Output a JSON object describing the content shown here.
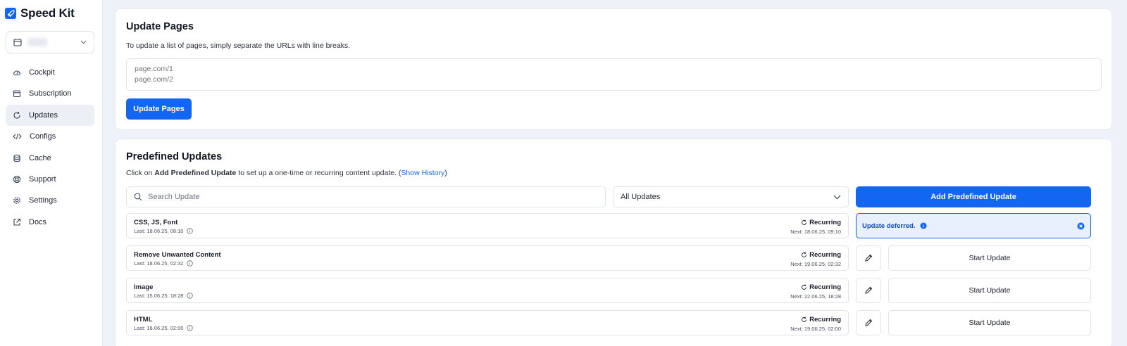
{
  "brand": {
    "name": "Speed Kit"
  },
  "sidebar": {
    "items": [
      {
        "label": "Cockpit",
        "icon": "gauge-icon",
        "active": false
      },
      {
        "label": "Subscription",
        "icon": "calendar-icon",
        "active": false
      },
      {
        "label": "Updates",
        "icon": "refresh-icon",
        "active": true
      },
      {
        "label": "Configs",
        "icon": "code-icon",
        "active": false
      },
      {
        "label": "Cache",
        "icon": "database-icon",
        "active": false
      },
      {
        "label": "Support",
        "icon": "lifebuoy-icon",
        "active": false
      },
      {
        "label": "Settings",
        "icon": "gear-icon",
        "active": false
      },
      {
        "label": "Docs",
        "icon": "external-link-icon",
        "active": false
      }
    ]
  },
  "update_pages": {
    "title": "Update Pages",
    "description": "To update a list of pages, simply separate the URLs with line breaks.",
    "placeholder": "page.com/1\npage.com/2",
    "button_label": "Update Pages"
  },
  "predefined": {
    "title": "Predefined Updates",
    "desc_prefix": "Click on ",
    "desc_bold": "Add Predefined Update",
    "desc_middle": " to set up a one-time or recurring content update. (",
    "desc_link": "Show History",
    "desc_suffix": ")",
    "search_placeholder": "Search Update",
    "filter_value": "All Updates",
    "add_button": "Add Predefined Update",
    "deferred_text": "Update deferred.",
    "start_label": "Start Update",
    "rows": [
      {
        "name": "CSS, JS, Font",
        "last": "Last: 18.06.25, 08:10",
        "type": "Recurring",
        "next": "Next: 18.06.25, 09:10"
      },
      {
        "name": "Remove Unwanted Content",
        "last": "Last: 18.06.25, 02:32",
        "type": "Recurring",
        "next": "Next: 19.06.25, 02:32"
      },
      {
        "name": "Image",
        "last": "Last: 15.06.25, 18:28",
        "type": "Recurring",
        "next": "Next: 22.06.25, 18:28"
      },
      {
        "name": "HTML",
        "last": "Last: 18.06.25, 02:00",
        "type": "Recurring",
        "next": "Next: 19.06.25, 02:00"
      }
    ]
  },
  "colors": {
    "accent": "#1266f1",
    "background": "#eef1f7",
    "deferred_bg": "#e8f0fe"
  }
}
